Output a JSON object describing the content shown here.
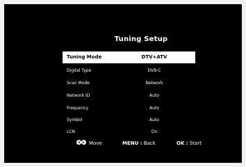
{
  "title": "Tuning Setup",
  "rows": [
    {
      "label": "Tuning Mode",
      "value": "DTV+ATV"
    },
    {
      "label": "Digital Type",
      "value": "DVB-C"
    },
    {
      "label": "Scan Mode",
      "value": "Network"
    },
    {
      "label": "Network ID",
      "value": "Auto"
    },
    {
      "label": "Frequency",
      "value": "Auto"
    },
    {
      "label": "Symbol",
      "value": "Auto"
    },
    {
      "label": "LCN",
      "value": "On"
    }
  ],
  "footer": {
    "move_label": "Move",
    "menu_key": "MENU :",
    "menu_action": "Back",
    "ok_key": "OK :",
    "ok_action": "Start"
  },
  "colors": {
    "background": "#000000",
    "text": "#ffffff",
    "highlight": "#ffffff",
    "highlight_text": "#000000"
  },
  "icons": {
    "move": "left-right-arrows-icon"
  }
}
